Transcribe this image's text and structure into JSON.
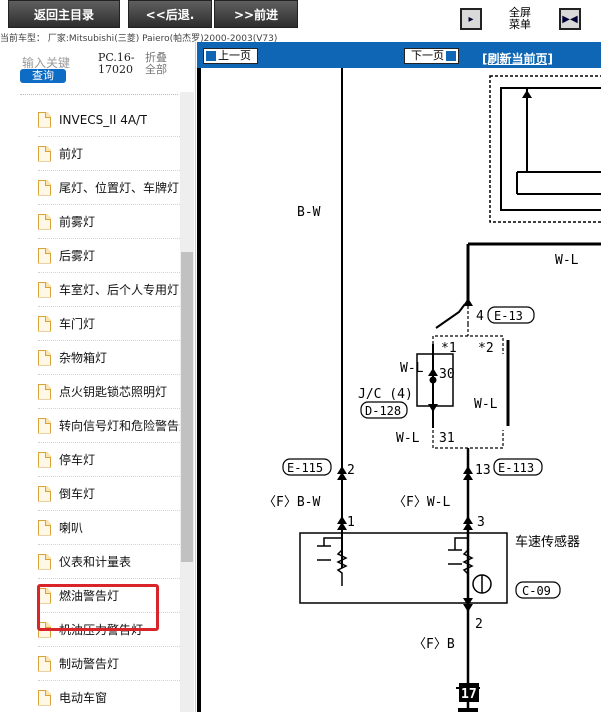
{
  "toolbar": {
    "home_label": "返回主目录",
    "back_label": "<<后退.",
    "forward_label": ">>前进",
    "fullscreen_label_line1": "全屏",
    "fullscreen_label_line2": "菜单",
    "vehicle_model": "当前车型： 厂家:Mitsubishi(三菱) Paiero(帕杰罗)2000-2003(V73)"
  },
  "sidebar": {
    "search_placeholder": "输入关键",
    "query_label": "查询",
    "code_line1": "PC.16-",
    "code_line2": "17020",
    "fold_line1": "折叠",
    "fold_line2": "全部",
    "items": [
      {
        "label": "INVECS_II 4A/T"
      },
      {
        "label": "前灯"
      },
      {
        "label": "尾灯、位置灯、车牌灯"
      },
      {
        "label": "前雾灯"
      },
      {
        "label": "后雾灯"
      },
      {
        "label": "车室灯、后个人专用灯"
      },
      {
        "label": "车门灯"
      },
      {
        "label": "杂物箱灯"
      },
      {
        "label": "点火钥匙锁芯照明灯"
      },
      {
        "label": "转向信号灯和危险警告灯"
      },
      {
        "label": "停车灯"
      },
      {
        "label": "倒车灯"
      },
      {
        "label": "喇叭"
      },
      {
        "label": "仪表和计量表"
      },
      {
        "label": "燃油警告灯"
      },
      {
        "label": "机油压力警告灯"
      },
      {
        "label": "制动警告灯"
      },
      {
        "label": "电动车窗"
      }
    ],
    "selected_index": 13
  },
  "viewer": {
    "prev_label": "上一页",
    "next_label": "下一页",
    "refresh_label": "[刷新当前页]"
  },
  "diagram": {
    "wire_bw": "B-W",
    "wire_wl_top": "W-L",
    "conn_e13": "E-13",
    "pin_4": "4",
    "star1": "*1",
    "star2": "*2",
    "wl_30": "W-L",
    "pin_30": "30",
    "jc_label": "J/C (4)",
    "conn_d128": "D-128",
    "wl_31": "W-L",
    "pin_31": "31",
    "wl_right": "W-L",
    "conn_e115": "E-115",
    "pin_2a": "2",
    "pin_13": "13",
    "conn_e113": "E-113",
    "f_bw": "〈F〉B-W",
    "f_wl": "〈F〉W-L",
    "pin_1": "1",
    "pin_3": "3",
    "sensor_label": "车速传感器",
    "conn_c09": "C-09",
    "pin_2b": "2",
    "f_b": "〈F〉B",
    "ground_num": "17"
  }
}
